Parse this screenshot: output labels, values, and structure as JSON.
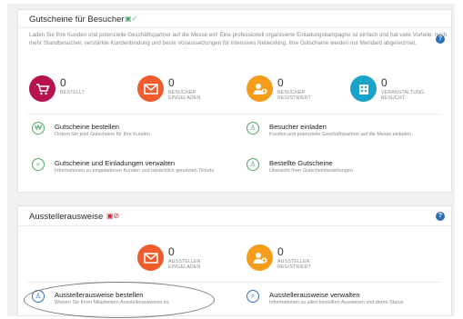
{
  "card1": {
    "title": "Gutscheine für Besucher",
    "intro": "Laden Sie Ihre Kunden und potenzielle Geschäftspartner auf die Messe ein! Eine professionell organisierte Einladungskampagne ist einfach und hat viele Vorteile: noch mehr Standbesucher, verstärkte Kundenbindung und beste Voraussetzungen für intensives Networking. Ihre Gutscheine werden nur Meridard abgerechnet.",
    "stats": [
      {
        "value": "0",
        "label": "BESTELLT",
        "icon": "cart-icon",
        "color": "#b5124f"
      },
      {
        "value": "0",
        "label": "BESUCHER EINGELADEN",
        "icon": "envelope-icon",
        "color": "#ef5c2b"
      },
      {
        "value": "0",
        "label": "BESUCHER REGISTRIERT",
        "icon": "user-plus-icon",
        "color": "#f59c1a"
      },
      {
        "value": "0",
        "label": "VERANSTALTUNG BESUCHT",
        "icon": "building-icon",
        "color": "#1aa3c9"
      }
    ],
    "actions": [
      {
        "title": "Gutscheine bestellen",
        "desc": "Ordern Sie jetzt Gutscheine für Ihre Kunden"
      },
      {
        "title": "Besucher einladen",
        "desc": "Kunden und potenzielle Geschäftspartner auf die Messe einladen"
      },
      {
        "title": "Gutscheine und Einladungen verwalten",
        "desc": "Informationen zu eingeladenen Kunden und tatsächlich genutzten Tickets"
      },
      {
        "title": "Bestellte Gutscheine",
        "desc": "Übersicht Ihrer Gutscheinbestellungen"
      }
    ]
  },
  "card2": {
    "title": "Ausstellerausweise",
    "stats": [
      {
        "value": "0",
        "label": "AUSSTELLER EINGELADEN",
        "icon": "envelope-icon",
        "color": "#ef5c2b"
      },
      {
        "value": "0",
        "label": "AUSSTELLER REGISTRIERT",
        "icon": "user-plus-icon",
        "color": "#f59c1a"
      }
    ],
    "actions": [
      {
        "title": "Ausstellerausweise bestellen",
        "desc": "Weisen Sie Ihren Mitarbeitern Ausstellerausweise zu"
      },
      {
        "title": "Ausstellerausweise verwalten",
        "desc": "Informationen zu allen bestellten Ausweisen und deren Status"
      }
    ]
  }
}
